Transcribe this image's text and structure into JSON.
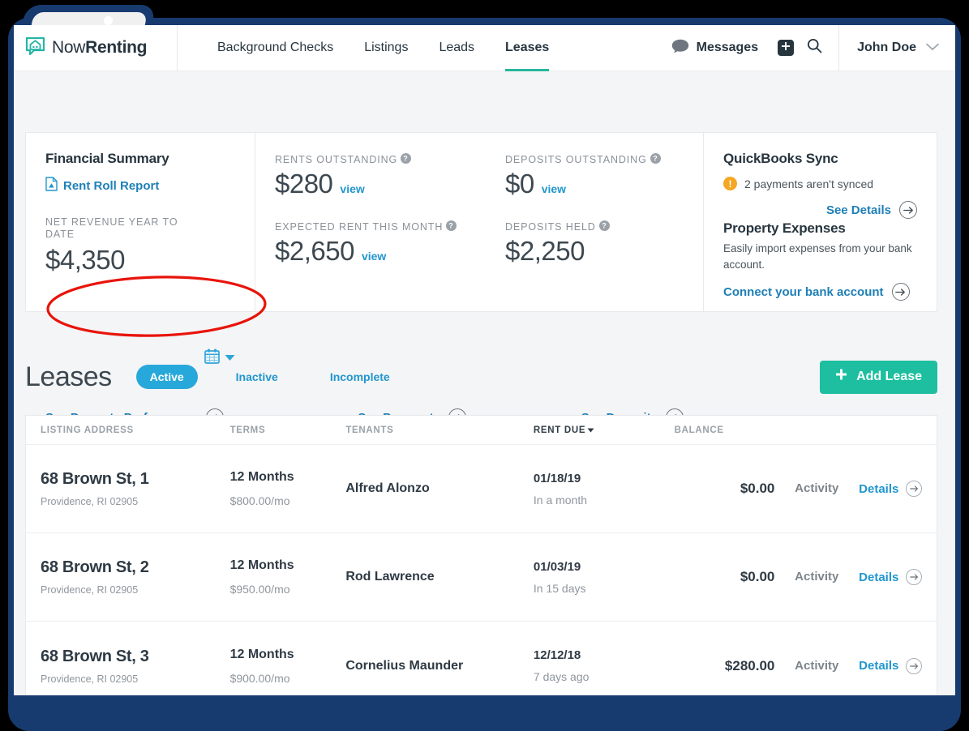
{
  "header": {
    "brand_light": "Now",
    "brand_bold": "Renting",
    "logo_icon": "house-chat-logo",
    "nav": [
      {
        "label": "Background Checks",
        "active": false
      },
      {
        "label": "Listings",
        "active": false
      },
      {
        "label": "Leads",
        "active": false
      },
      {
        "label": "Leases",
        "active": true
      }
    ],
    "messages_label": "Messages",
    "messages_icon": "speech-bubble-icon",
    "add_icon": "plus-square-icon",
    "search_icon": "search-icon",
    "user_name": "John Doe",
    "user_caret_icon": "chevron-down-icon"
  },
  "summary": {
    "financial_title": "Financial Summary",
    "rent_roll_label": "Rent Roll Report",
    "rent_roll_icon": "pdf-file-icon",
    "net_revenue_label": "NET REVENUE YEAR TO DATE",
    "net_revenue_value": "$4,350",
    "calendar_icon": "calendar-icon",
    "calendar_caret_icon": "caret-down-icon",
    "see_property_performance": "See Property Performance",
    "rents_outstanding_label": "RENTS OUTSTANDING",
    "rents_outstanding_value": "$280",
    "rents_outstanding_view": "view",
    "expected_rent_label": "EXPECTED RENT THIS MONTH",
    "expected_rent_value": "$2,650",
    "expected_rent_view": "view",
    "see_payments": "See Payments",
    "deposits_outstanding_label": "DEPOSITS OUTSTANDING",
    "deposits_outstanding_value": "$0",
    "deposits_outstanding_view": "view",
    "deposits_held_label": "DEPOSITS HELD",
    "deposits_held_value": "$2,250",
    "see_deposits": "See Deposits",
    "quickbooks_title": "QuickBooks Sync",
    "quickbooks_warning": "2 payments aren't synced",
    "warning_icon": "exclamation-circle-icon",
    "see_details": "See Details",
    "property_expenses_title": "Property Expenses",
    "property_expenses_desc": "Easily import expenses from your bank account.",
    "connect_bank": "Connect your bank account",
    "help_icon": "help-circle-icon",
    "arrow_icon": "arrow-right-circle-icon"
  },
  "leases": {
    "title": "Leases",
    "filters": [
      {
        "label": "Active",
        "active": true
      },
      {
        "label": "Inactive",
        "active": false
      },
      {
        "label": "Incomplete",
        "active": false
      }
    ],
    "add_button": "Add Lease",
    "add_button_icon": "plus-icon",
    "columns": [
      "LISTING ADDRESS",
      "TERMS",
      "TENANTS",
      "RENT DUE",
      "BALANCE",
      "",
      ""
    ],
    "sort_column": "RENT DUE",
    "sort_caret_icon": "caret-down-icon",
    "rows": [
      {
        "address": "68 Brown St, 1",
        "city": "Providence, RI 02905",
        "term": "12 Months",
        "rent": "$800.00/mo",
        "tenant": "Alfred Alonzo",
        "due_date": "01/18/19",
        "due_rel": "In a month",
        "balance": "$0.00",
        "activity": "Activity",
        "details": "Details"
      },
      {
        "address": "68 Brown St, 2",
        "city": "Providence, RI 02905",
        "term": "12 Months",
        "rent": "$950.00/mo",
        "tenant": "Rod Lawrence",
        "due_date": "01/03/19",
        "due_rel": "In 15 days",
        "balance": "$0.00",
        "activity": "Activity",
        "details": "Details"
      },
      {
        "address": "68 Brown St, 3",
        "city": "Providence, RI 02905",
        "term": "12 Months",
        "rent": "$900.00/mo",
        "tenant": "Cornelius Maunder",
        "due_date": "12/12/18",
        "due_rel": "7 days ago",
        "balance": "$280.00",
        "activity": "Activity",
        "details": "Details"
      }
    ]
  },
  "annotation": {
    "shape": "red-ellipse-highlight",
    "color": "#E8140B"
  },
  "colors": {
    "brand_teal": "#27B79B",
    "link_blue": "#2196CE",
    "pill_blue": "#27A8DB",
    "add_green": "#1DBFA0",
    "warning_orange": "#F5A623",
    "frame_navy": "#173B6E",
    "text_dark": "#27353F"
  }
}
